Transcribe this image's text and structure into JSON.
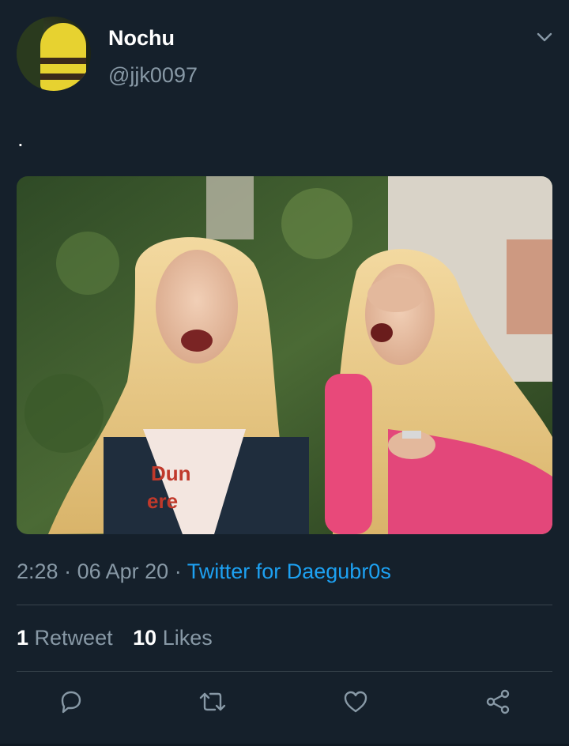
{
  "tweet": {
    "author_name": "Nochu",
    "author_handle": "@jjk0097",
    "text": ".",
    "time": "2:28",
    "date": "06 Apr 20",
    "source": "Twitter for Daegubr0s",
    "separator": "·"
  },
  "stats": {
    "retweets_count": "1",
    "retweets_label": "Retweet",
    "likes_count": "10",
    "likes_label": "Likes"
  },
  "icons": {
    "menu": "chevron-down-icon",
    "reply": "reply-icon",
    "retweet": "retweet-icon",
    "like": "heart-icon",
    "share": "share-icon"
  },
  "colors": {
    "background": "#15202b",
    "secondary_text": "#8899a6",
    "accent": "#1da1f2",
    "divider": "#38444d"
  }
}
